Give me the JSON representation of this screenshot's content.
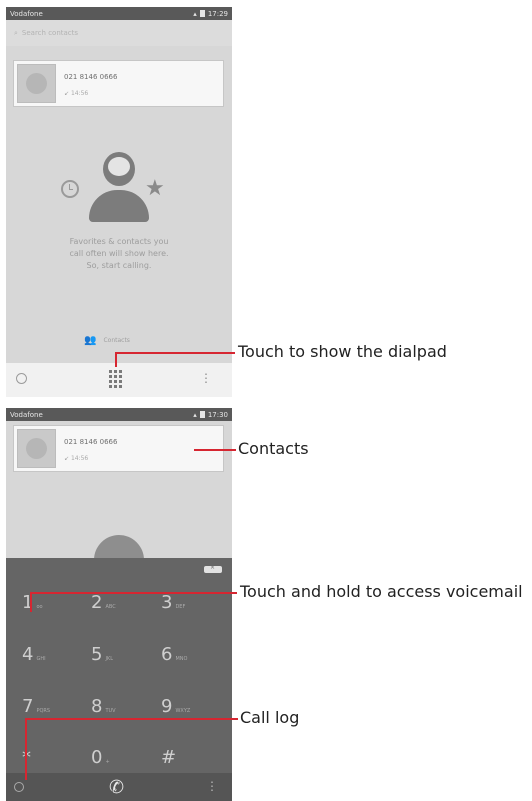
{
  "phone1": {
    "status_left": "Vodafone",
    "status_time": "17:29",
    "search_placeholder": "Search contacts",
    "contact_number": "021 8146 0666",
    "contact_time": "14:56",
    "empty_text_line1": "Favorites & contacts you",
    "empty_text_line2": "call often will show here.",
    "empty_text_line3": "So, start calling.",
    "contacts_label": "Contacts"
  },
  "phone2": {
    "status_left": "Vodafone",
    "status_time": "17:30",
    "contact_number": "021 8146 0666",
    "contact_time": "14:56",
    "keys": [
      {
        "num": "1",
        "letters": "oo"
      },
      {
        "num": "2",
        "letters": "ABC"
      },
      {
        "num": "3",
        "letters": "DEF"
      },
      {
        "num": "4",
        "letters": "GHI"
      },
      {
        "num": "5",
        "letters": "JKL"
      },
      {
        "num": "6",
        "letters": "MNO"
      },
      {
        "num": "7",
        "letters": "PQRS"
      },
      {
        "num": "8",
        "letters": "TUV"
      },
      {
        "num": "9",
        "letters": "WXYZ"
      },
      {
        "num": "*",
        "letters": ""
      },
      {
        "num": "0",
        "letters": "+"
      },
      {
        "num": "#",
        "letters": ""
      }
    ]
  },
  "callouts": {
    "dialpad": "Touch to show the dialpad",
    "contacts": "Contacts",
    "voicemail": "Touch and hold to access voicemail",
    "call_log": "Call log"
  },
  "colors": {
    "accent_red": "#d62631",
    "dialpad_overlay": "#656565"
  }
}
